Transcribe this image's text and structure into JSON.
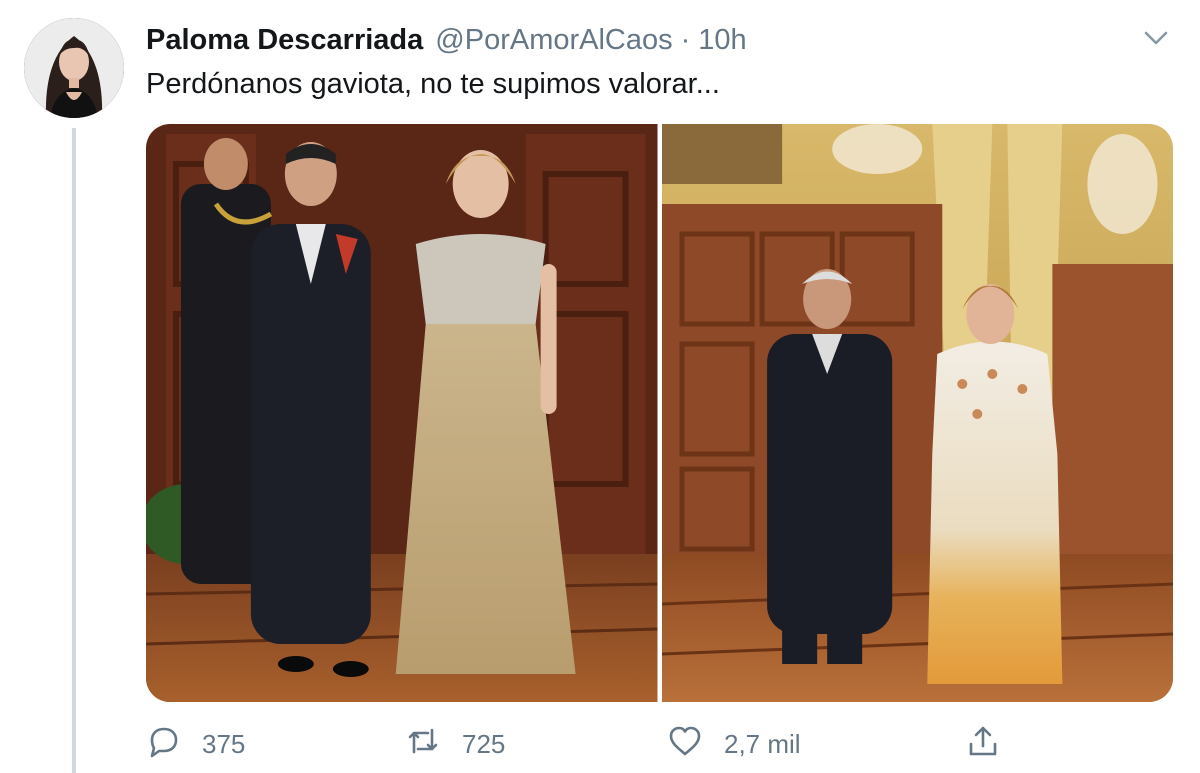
{
  "tweet": {
    "author_name": "Paloma Descarriada",
    "handle": "@PorAmorAlCaos",
    "separator": "·",
    "time": "10h",
    "text": "Perdónanos gaviota, no te supimos valorar...",
    "replies": "375",
    "retweets": "725",
    "likes": "2,7 mil"
  },
  "icons": {
    "menu": "chevron-down-icon",
    "reply": "reply-bubble-icon",
    "retweet": "retweet-icon",
    "like": "heart-icon",
    "share": "share-icon"
  },
  "colors": {
    "text": "#14171a",
    "muted": "#657786",
    "thread_line": "#cfd9de"
  }
}
